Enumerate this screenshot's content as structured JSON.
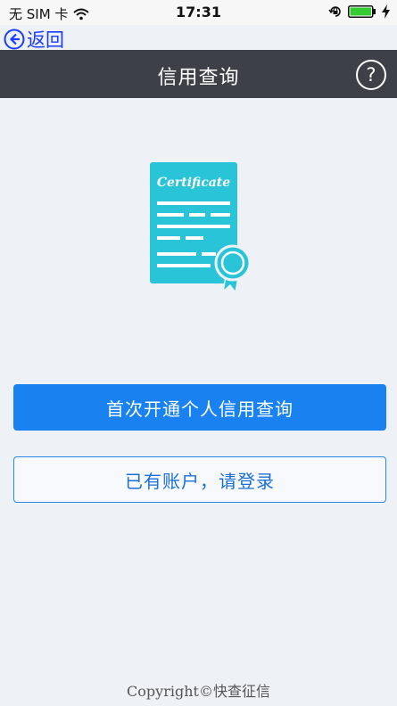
{
  "status_bar": {
    "carrier": "无 SIM 卡",
    "time": "17:31",
    "icons": [
      "wifi-icon",
      "lock-rotation-icon",
      "battery-icon",
      "charging-icon"
    ]
  },
  "back": {
    "label": "返回",
    "icon": "back-arrow-icon"
  },
  "nav": {
    "title": "信用查询",
    "help_label": "?"
  },
  "certificate": {
    "label": "Certificate",
    "color": "#29c4d8"
  },
  "buttons": {
    "primary": "首次开通个人信用查询",
    "secondary": "已有账户，请登录"
  },
  "footer": "Copyright©快查征信",
  "colors": {
    "accent": "#1a82f0",
    "nav_bg": "#3d4147",
    "page_bg": "#eef1f6"
  }
}
